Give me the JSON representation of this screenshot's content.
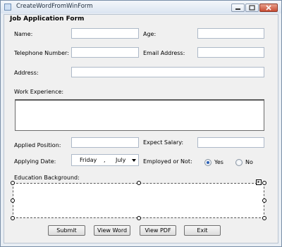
{
  "window": {
    "title": "CreateWordFromWinForm"
  },
  "form": {
    "heading": "Job Application Form",
    "labels": {
      "name": "Name:",
      "age": "Age:",
      "telephone": "Telephone Number:",
      "email": "Email Address:",
      "address": "Address:",
      "work_experience": "Work Experience:",
      "applied_position": "Applied Position:",
      "expect_salary": "Expect Salary:",
      "applying_date": "Applying Date:",
      "employed": "Employed or Not:",
      "education": "Education Background:"
    },
    "fields": {
      "name": "",
      "age": "",
      "telephone": "",
      "email": "",
      "address": "",
      "work_experience": "",
      "applied_position": "",
      "expect_salary": "",
      "education": ""
    },
    "date": {
      "weekday": "Friday",
      "separator": ",",
      "month": "July"
    },
    "employed_options": {
      "yes": "Yes",
      "no": "No",
      "selected": "yes"
    }
  },
  "buttons": {
    "submit": "Submit",
    "view_word": "View Word",
    "view_pdf": "View PDF",
    "exit": "Exit"
  },
  "icons": [
    "app-icon",
    "minimize-icon",
    "maximize-icon",
    "close-icon",
    "chevron-down-icon",
    "smart-tag-arrow-icon"
  ]
}
